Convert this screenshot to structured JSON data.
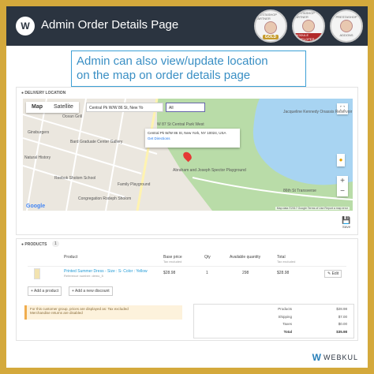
{
  "header": {
    "logo_letter": "W",
    "title": "Admin Order Details Page",
    "badges": [
      {
        "ring": "PRESTASHOP PARTNER",
        "tag": "GOLD"
      },
      {
        "ring": "PRESTASHOP PARTNER",
        "tag": "MODULE DEVELOPER"
      },
      {
        "ring": "PRESTASHOP",
        "tag": "ADDONS"
      }
    ]
  },
  "callout": {
    "line1": "Admin can also view/update location",
    "line2": "on the map on order details page"
  },
  "delivery": {
    "heading": "DELIVERY LOCATION",
    "map_tab_map": "Map",
    "map_tab_satellite": "Satellite",
    "search_value": "Central Pk W/W 86 St, New Yo",
    "select_value": "All",
    "info_line1": "Central Pk W/W 86 St, New York, NY 10024, USA",
    "info_directions": "Get Directions",
    "labels": {
      "l1": "W 87 St Central Park West",
      "l2": "Bard Graduate Center Gallery",
      "l3": "Ginsburgers",
      "l4": "Ocean Grill",
      "l5": "Natural History",
      "l6": "Abraham and Joseph Spector Playground",
      "l7": "Jacqueline Kennedy Onassis Reservoir",
      "l8": "Reebok Sholom School",
      "l9": "Family Playground",
      "l10": "Congregation Rodeph Sholom",
      "l11": "86th St Transverse"
    },
    "google": "Google",
    "attribution": "Map data ©2017 Google   Terms of Use   Report a map error",
    "save_label": "Save",
    "save_icon": "floppy-icon"
  },
  "products": {
    "heading": "PRODUCTS",
    "count": "1",
    "columns": {
      "product": "Product",
      "base_price": "Base price",
      "base_price_sub": "Tax excluded",
      "qty": "Qty",
      "available": "Available quantity",
      "total": "Total",
      "total_sub": "Tax excluded"
    },
    "row": {
      "name": "Printed Summer Dress - Size : S- Color : Yellow",
      "reference": "Reference number: demo_5",
      "base_price": "$28.98",
      "qty": "1",
      "available": "298",
      "total": "$28.98",
      "edit": "Edit"
    },
    "add_product": "Add a product",
    "add_discount": "Add a new discount",
    "alert_line1": "For this customer group, prices are displayed as: Tax excluded",
    "alert_line2": "Merchandise returns are disabled",
    "totals": [
      {
        "k": "Products",
        "v": "$28.98"
      },
      {
        "k": "Shipping",
        "v": "$7.00"
      },
      {
        "k": "Taxes",
        "v": "$0.00"
      },
      {
        "k": "Total",
        "v": "$35.98"
      }
    ]
  },
  "footer": {
    "brand": "WEBKUL"
  },
  "colors": {
    "border_gold": "#d4a93c",
    "header_bg": "#2b3440",
    "callout_blue": "#3a8fc4",
    "park_green": "#b9dca8",
    "water_blue": "#a8d4f2"
  }
}
